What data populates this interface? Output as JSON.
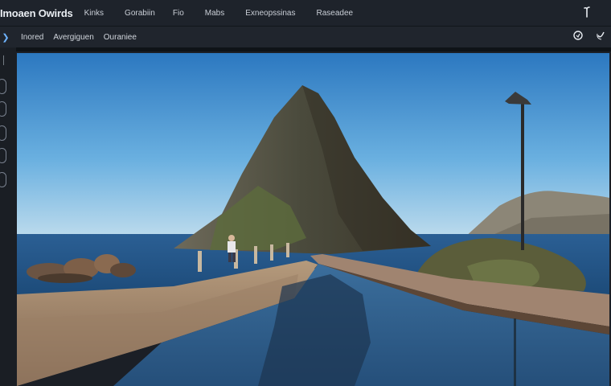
{
  "app": {
    "title": "Imoaen Owirds"
  },
  "menu": {
    "items": [
      "Kinks",
      "Gorabiin",
      "Fio",
      "Mabs",
      "Exneopssinas",
      "Raseadee"
    ]
  },
  "toolbar": {
    "tabs": [
      "Inored",
      "Avergiguen",
      "Ouraniee"
    ]
  },
  "icons": {
    "topbar_right": "cursor-icon",
    "subbar_left": "arrow-icon",
    "subbar_right": [
      "shield-icon",
      "check-icon"
    ],
    "rail": [
      "tool-icon",
      "circle-button",
      "circle-button",
      "circle-button",
      "circle-button",
      "circle-button"
    ]
  },
  "colors": {
    "sky_top": "#2f7fc7",
    "sky_bottom": "#b9d8ec",
    "sea": "#2f6aa2",
    "chrome": "#1e232b"
  },
  "image": {
    "alt": ""
  }
}
